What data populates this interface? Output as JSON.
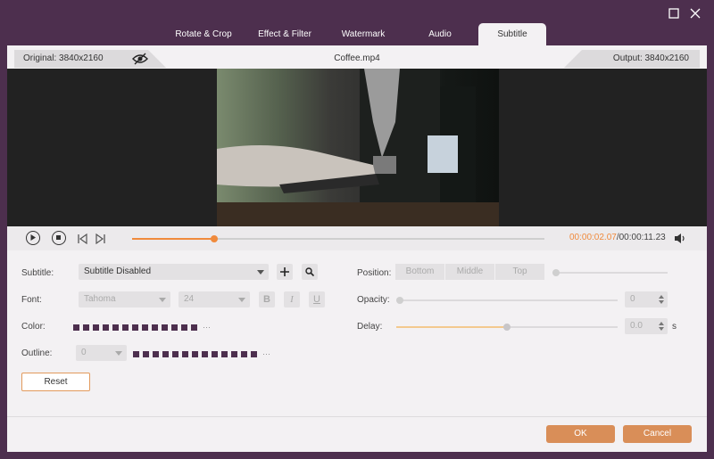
{
  "tabs": [
    "Rotate & Crop",
    "Effect & Filter",
    "Watermark",
    "Audio",
    "Subtitle"
  ],
  "active_tab": "Subtitle",
  "info": {
    "original": "Original: 3840x2160",
    "filename": "Coffee.mp4",
    "output": "Output: 3840x2160"
  },
  "player": {
    "current_time": "00:00:02.07",
    "separator": "/",
    "total_time": "00:00:11.23",
    "progress": 0.2
  },
  "subtitle": {
    "label": "Subtitle:",
    "value": "Subtitle Disabled",
    "font_label": "Font:",
    "font_value": "Tahoma",
    "size_value": "24",
    "bold": "B",
    "italic": "I",
    "underline": "U",
    "color_label": "Color:",
    "outline_label": "Outline:",
    "outline_value": "0",
    "reset": "Reset"
  },
  "position": {
    "label": "Position:",
    "options": [
      "Bottom",
      "Middle",
      "Top"
    ]
  },
  "opacity": {
    "label": "Opacity:",
    "value": "0"
  },
  "delay": {
    "label": "Delay:",
    "value": "0.0",
    "unit": "s",
    "level": 0.5
  },
  "footer": {
    "ok": "OK",
    "cancel": "Cancel"
  },
  "colors": {
    "accent": "#f08a3c",
    "brand": "#4d2f4e",
    "button": "#d98e58"
  }
}
